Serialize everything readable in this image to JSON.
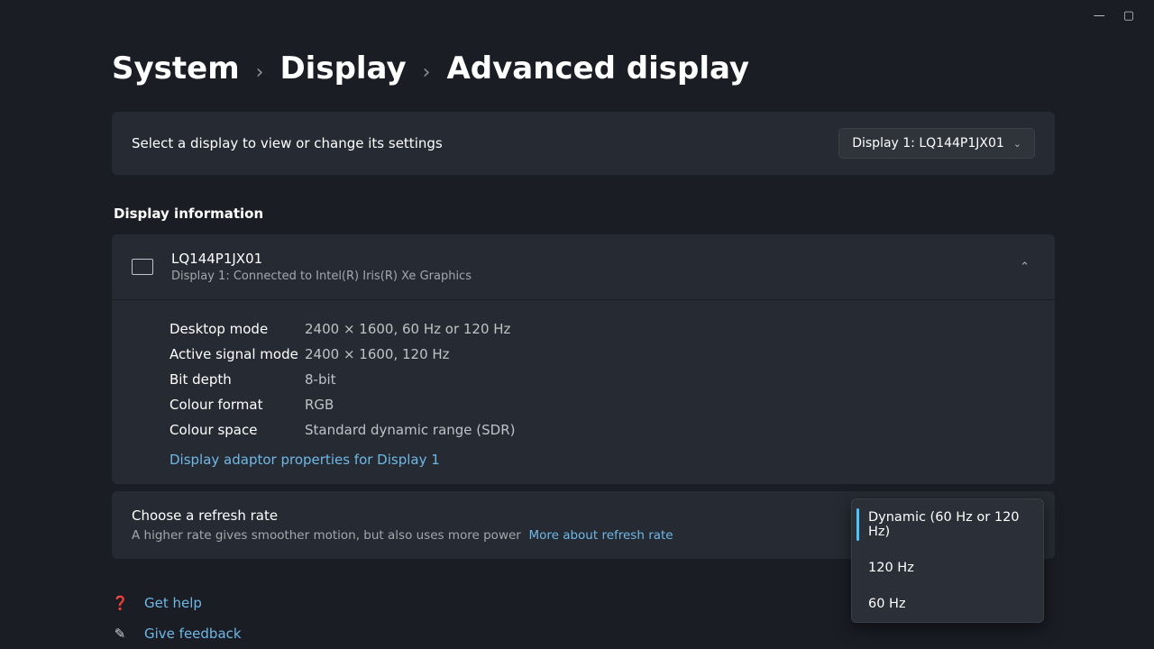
{
  "breadcrumb": {
    "system": "System",
    "display": "Display",
    "advanced": "Advanced display"
  },
  "select_display": {
    "label": "Select a display to view or change its settings",
    "value": "Display 1: LQ144P1JX01"
  },
  "display_info": {
    "heading": "Display information",
    "title": "LQ144P1JX01",
    "subtitle": "Display 1: Connected to Intel(R) Iris(R) Xe Graphics",
    "rows": [
      {
        "key": "Desktop mode",
        "val": "2400 × 1600, 60 Hz or 120 Hz"
      },
      {
        "key": "Active signal mode",
        "val": "2400 × 1600, 120 Hz"
      },
      {
        "key": "Bit depth",
        "val": "8-bit"
      },
      {
        "key": "Colour format",
        "val": "RGB"
      },
      {
        "key": "Colour space",
        "val": "Standard dynamic range (SDR)"
      }
    ],
    "adapter_link": "Display adaptor properties for Display 1"
  },
  "refresh": {
    "title": "Choose a refresh rate",
    "subtitle": "A higher rate gives smoother motion, but also uses more power",
    "more_link": "More about refresh rate",
    "options": [
      "Dynamic (60 Hz or 120 Hz)",
      "120 Hz",
      "60 Hz"
    ]
  },
  "footer": {
    "help": "Get help",
    "feedback": "Give feedback"
  }
}
